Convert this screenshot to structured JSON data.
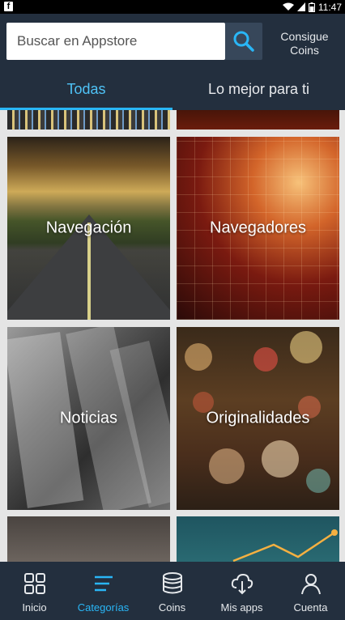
{
  "status_bar": {
    "time": "11:47",
    "app_icon": "f"
  },
  "header": {
    "search_placeholder": "Buscar en Appstore",
    "coins_line1": "Consigue",
    "coins_line2": "Coins",
    "tabs": [
      {
        "label": "Todas",
        "active": true
      },
      {
        "label": "Lo mejor para ti",
        "active": false
      }
    ]
  },
  "categories": [
    {
      "label": "Navegación"
    },
    {
      "label": "Navegadores"
    },
    {
      "label": "Noticias"
    },
    {
      "label": "Originalidades"
    }
  ],
  "bottom_nav": [
    {
      "label": "Inicio",
      "icon": "grid-icon",
      "active": false
    },
    {
      "label": "Categorías",
      "icon": "menu-icon",
      "active": true
    },
    {
      "label": "Coins",
      "icon": "coins-icon",
      "active": false
    },
    {
      "label": "Mis apps",
      "icon": "cloud-download-icon",
      "active": false
    },
    {
      "label": "Cuenta",
      "icon": "person-icon",
      "active": false
    }
  ],
  "colors": {
    "header_bg": "#232f3e",
    "accent": "#29b6f6",
    "search_btn_bg": "#37475a"
  }
}
